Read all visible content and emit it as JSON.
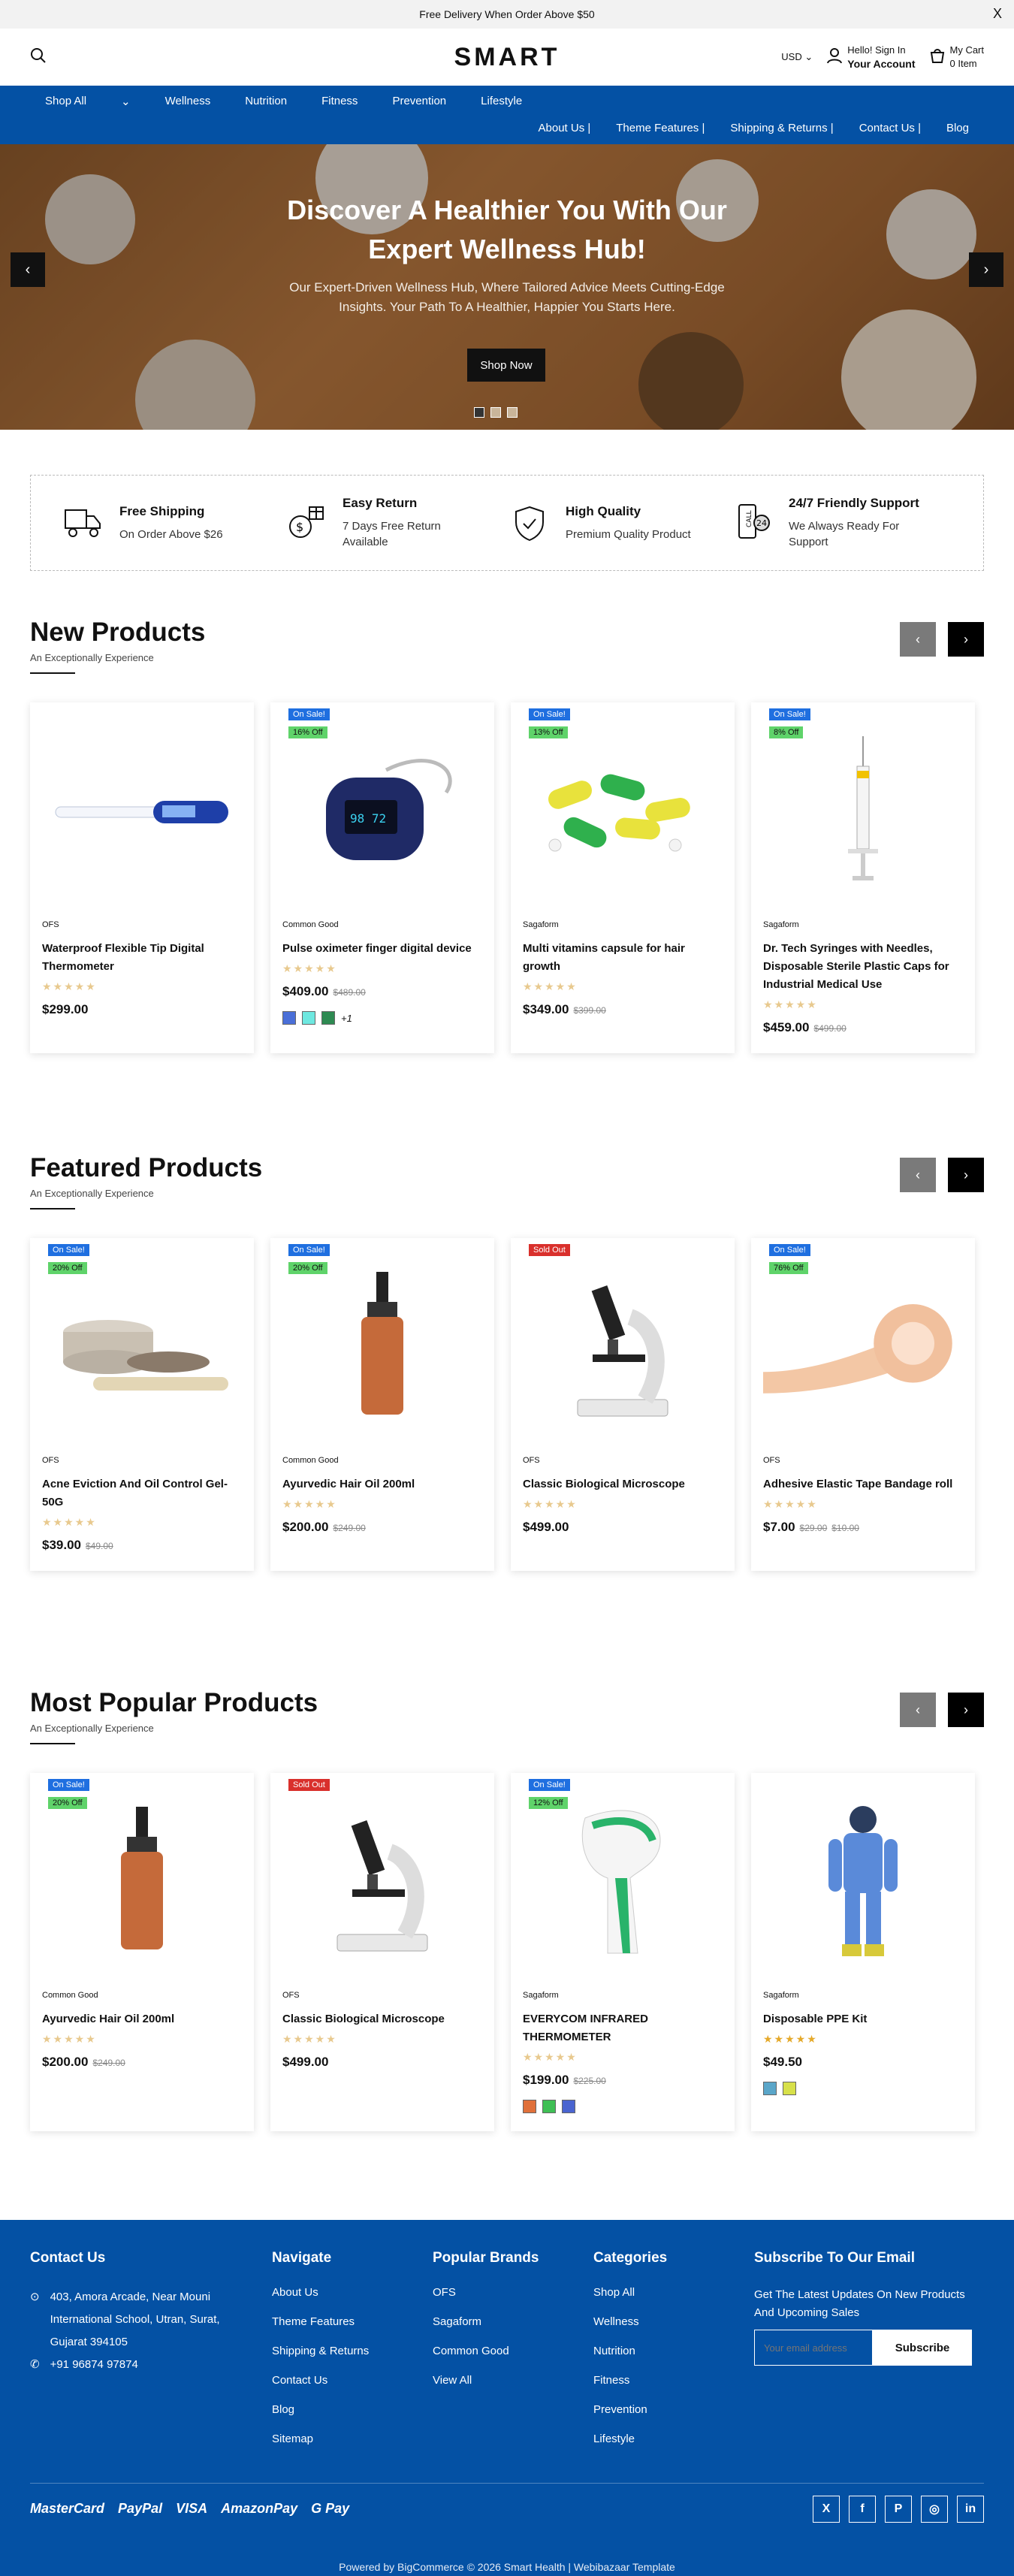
{
  "topbar": {
    "text": "Free Delivery When Order Above $50",
    "close": "X"
  },
  "header": {
    "logo": "SMART",
    "currency": "USD",
    "greeting": "Hello! Sign In",
    "account": "Your Account",
    "cart_title": "My Cart",
    "cart_count": "0 Item"
  },
  "nav": {
    "primary": [
      "Shop All",
      "Wellness",
      "Nutrition",
      "Fitness",
      "Prevention",
      "Lifestyle"
    ],
    "secondary": [
      "About Us |",
      "Theme Features |",
      "Shipping & Returns |",
      "Contact Us |",
      "Blog"
    ]
  },
  "hero": {
    "title": "Discover A Healthier You With Our Expert Wellness Hub!",
    "text": "Our Expert-Driven Wellness Hub, Where Tailored Advice Meets Cutting-Edge Insights. Your Path To A Healthier, Happier You Starts Here.",
    "cta": "Shop Now",
    "prev": "‹",
    "next": "›"
  },
  "features": [
    {
      "title": "Free Shipping",
      "text": "On Order Above $26",
      "icon": "truck-icon"
    },
    {
      "title": "Easy Return",
      "text": "7 Days Free Return Available",
      "icon": "return-icon"
    },
    {
      "title": "High Quality",
      "text": "Premium Quality Product",
      "icon": "quality-icon"
    },
    {
      "title": "24/7 Friendly Support",
      "text": "We Always Ready For Support",
      "icon": "support-icon"
    }
  ],
  "sections": [
    {
      "title": "New Products",
      "subtitle": "An Exceptionally Experience",
      "products": [
        {
          "brand": "OFS",
          "name": "Waterproof Flexible Tip Digital Thermometer",
          "price": "$299.00",
          "old": "",
          "badges": [],
          "kind": "thermo",
          "swatches": []
        },
        {
          "brand": "Common Good",
          "name": "Pulse oximeter finger digital device",
          "price": "$409.00",
          "old": "$489.00",
          "badges": [
            "On Sale!",
            "16% Off"
          ],
          "kind": "oximeter",
          "swatches": [
            "#4a6fd8",
            "#6ee8e0",
            "#2e8a52"
          ],
          "more": "+1"
        },
        {
          "brand": "Sagaform",
          "name": "Multi vitamins capsule for hair growth",
          "price": "$349.00",
          "old": "$399.00",
          "badges": [
            "On Sale!",
            "13% Off"
          ],
          "kind": "capsules",
          "swatches": []
        },
        {
          "brand": "Sagaform",
          "name": "Dr. Tech Syringes with Needles, Disposable Sterile Plastic Caps for Industrial Medical Use",
          "price": "$459.00",
          "old": "$499.00",
          "badges": [
            "On Sale!",
            "8% Off"
          ],
          "kind": "syringe",
          "swatches": []
        }
      ]
    },
    {
      "title": "Featured Products",
      "subtitle": "An Exceptionally Experience",
      "products": [
        {
          "brand": "OFS",
          "name": "Acne Eviction And Oil Control Gel-50G",
          "price": "$39.00",
          "old": "$49.00",
          "badges": [
            "On Sale!",
            "20% Off"
          ],
          "kind": "jars",
          "swatches": []
        },
        {
          "brand": "Common Good",
          "name": "Ayurvedic Hair Oil 200ml",
          "price": "$200.00",
          "old": "$249.00",
          "badges": [
            "On Sale!",
            "20% Off"
          ],
          "kind": "bottle",
          "swatches": []
        },
        {
          "brand": "OFS",
          "name": "Classic Biological Microscope",
          "price": "$499.00",
          "old": "",
          "badges": [
            "Sold Out"
          ],
          "kind": "microscope",
          "swatches": []
        },
        {
          "brand": "OFS",
          "name": "Adhesive Elastic Tape Bandage roll",
          "price": "$7.00",
          "old": "$29.00",
          "old2": "$10.00",
          "badges": [
            "On Sale!",
            "76% Off"
          ],
          "kind": "tape",
          "swatches": []
        }
      ]
    },
    {
      "title": "Most Popular Products",
      "subtitle": "An Exceptionally Experience",
      "products": [
        {
          "brand": "Common Good",
          "name": "Ayurvedic Hair Oil 200ml",
          "price": "$200.00",
          "old": "$249.00",
          "badges": [
            "On Sale!",
            "20% Off"
          ],
          "kind": "bottle",
          "swatches": []
        },
        {
          "brand": "OFS",
          "name": "Classic Biological Microscope",
          "price": "$499.00",
          "old": "",
          "badges": [
            "Sold Out"
          ],
          "kind": "microscope",
          "swatches": []
        },
        {
          "brand": "Sagaform",
          "name": "EVERYCOM INFRARED THERMOMETER",
          "price": "$199.00",
          "old": "$225.00",
          "badges": [
            "On Sale!",
            "12% Off"
          ],
          "kind": "irthermo",
          "swatches": [
            "#e0703a",
            "#3fbf55",
            "#4a64d0"
          ]
        },
        {
          "brand": "Sagaform",
          "name": "Disposable PPE Kit",
          "price": "$49.50",
          "old": "",
          "badges": [],
          "kind": "ppe",
          "swatches": [
            "#5aa6c9",
            "#d7e04a"
          ],
          "gold": true
        }
      ]
    }
  ],
  "footer": {
    "contact_title": "Contact Us",
    "address": "403, Amora Arcade, Near Mouni International School, Utran, Surat, Gujarat 394105",
    "phone": "+91 96874 97874",
    "navigate_title": "Navigate",
    "navigate": [
      "About Us",
      "Theme Features",
      "Shipping & Returns",
      "Contact Us",
      "Blog",
      "Sitemap"
    ],
    "brands_title": "Popular Brands",
    "brands": [
      "OFS",
      "Sagaform",
      "Common Good",
      "View All"
    ],
    "categories_title": "Categories",
    "categories": [
      "Shop All",
      "Wellness",
      "Nutrition",
      "Fitness",
      "Prevention",
      "Lifestyle"
    ],
    "subscribe_title": "Subscribe To Our Email",
    "subscribe_text": "Get The Latest Updates On New Products And Upcoming Sales",
    "email_placeholder": "Your email address",
    "subscribe_btn": "Subscribe",
    "payments": [
      "MasterCard",
      "PayPal",
      "VISA",
      "AmazonPay",
      "G Pay"
    ],
    "social": [
      "X",
      "f",
      "P",
      "◎",
      "in"
    ],
    "copyright": "Powered by BigCommerce © 2026 Smart Health | Webibazaar Template"
  }
}
